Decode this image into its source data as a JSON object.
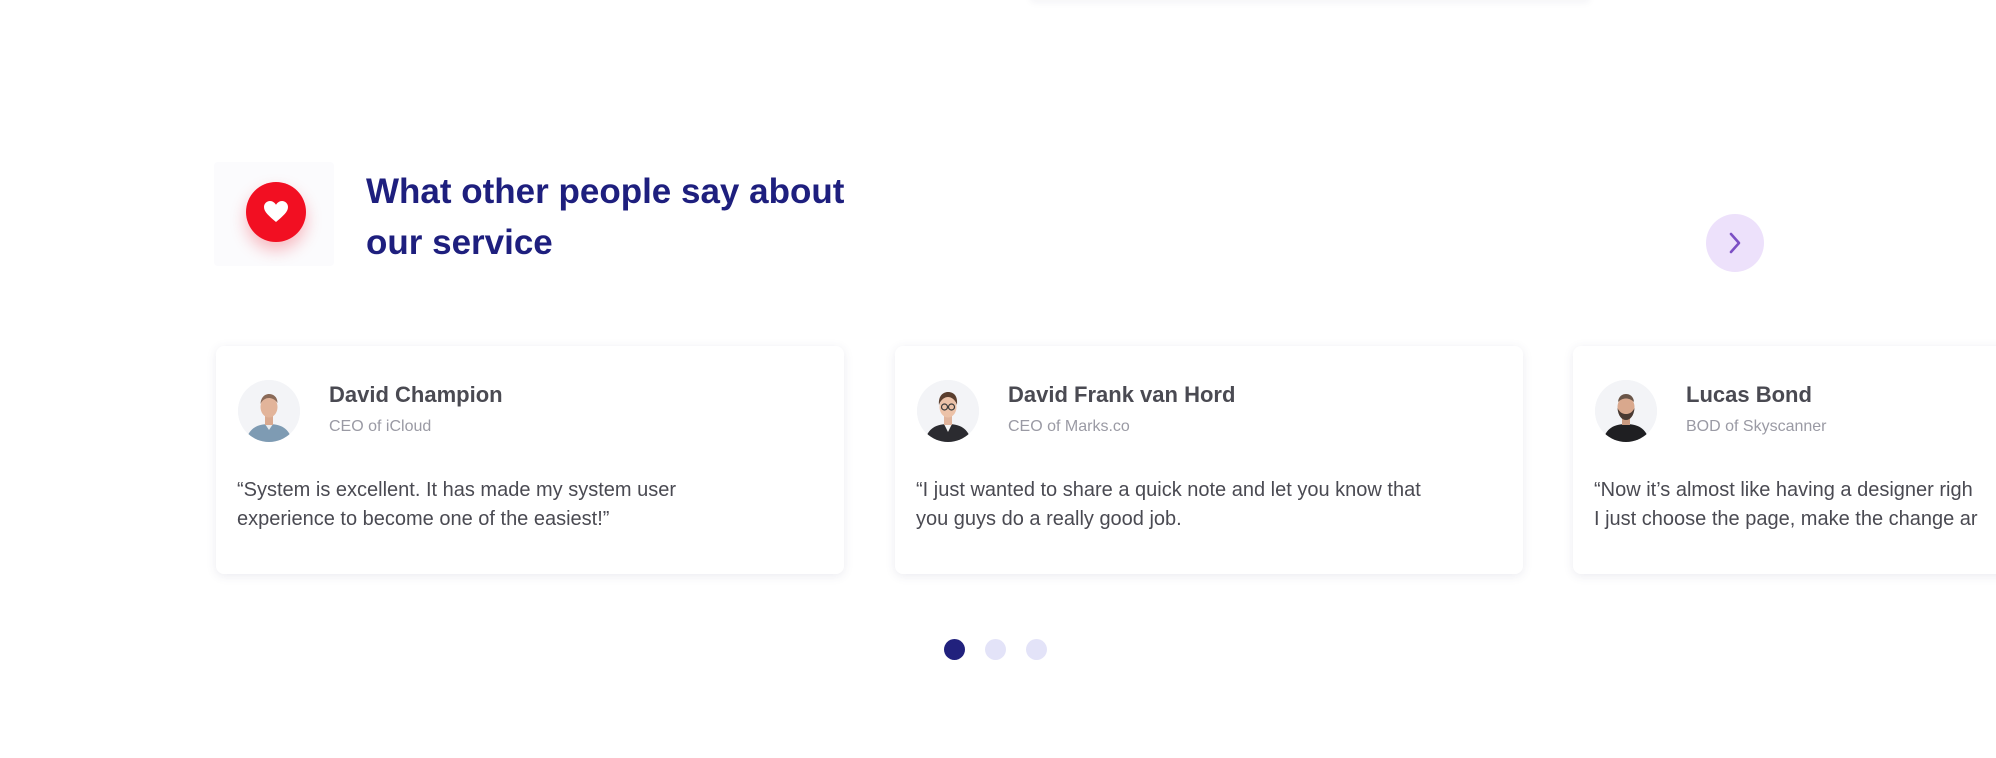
{
  "section": {
    "heading_line1": "What other people say about",
    "heading_line2": "our service"
  },
  "icons": {
    "heart": "heart-icon",
    "next": "chevron-right-icon"
  },
  "colors": {
    "heading": "#1e1f7e",
    "heart_badge": "#f20f22",
    "next_button_bg": "#ede1fb",
    "next_chevron": "#7c4fc4",
    "dot_active": "#21217d",
    "dot_inactive": "#e3e3f8"
  },
  "testimonials": [
    {
      "name": "David Champion",
      "role": "CEO of iCloud",
      "quote_line1": "“System is excellent. It has made my system user",
      "quote_line2": "experience to become one of the easiest!”"
    },
    {
      "name": "David Frank van Hord",
      "role": "CEO of Marks.co",
      "quote_line1": "“I just wanted to share a quick note and let you know that",
      "quote_line2": "you guys do a really good job."
    },
    {
      "name": "Lucas Bond",
      "role": "BOD of Skyscanner",
      "quote_line1": "“Now it’s almost like having a designer righ",
      "quote_line2": "I just choose the page, make the change ar"
    }
  ],
  "pagination": {
    "active_index": 0,
    "count": 3
  }
}
